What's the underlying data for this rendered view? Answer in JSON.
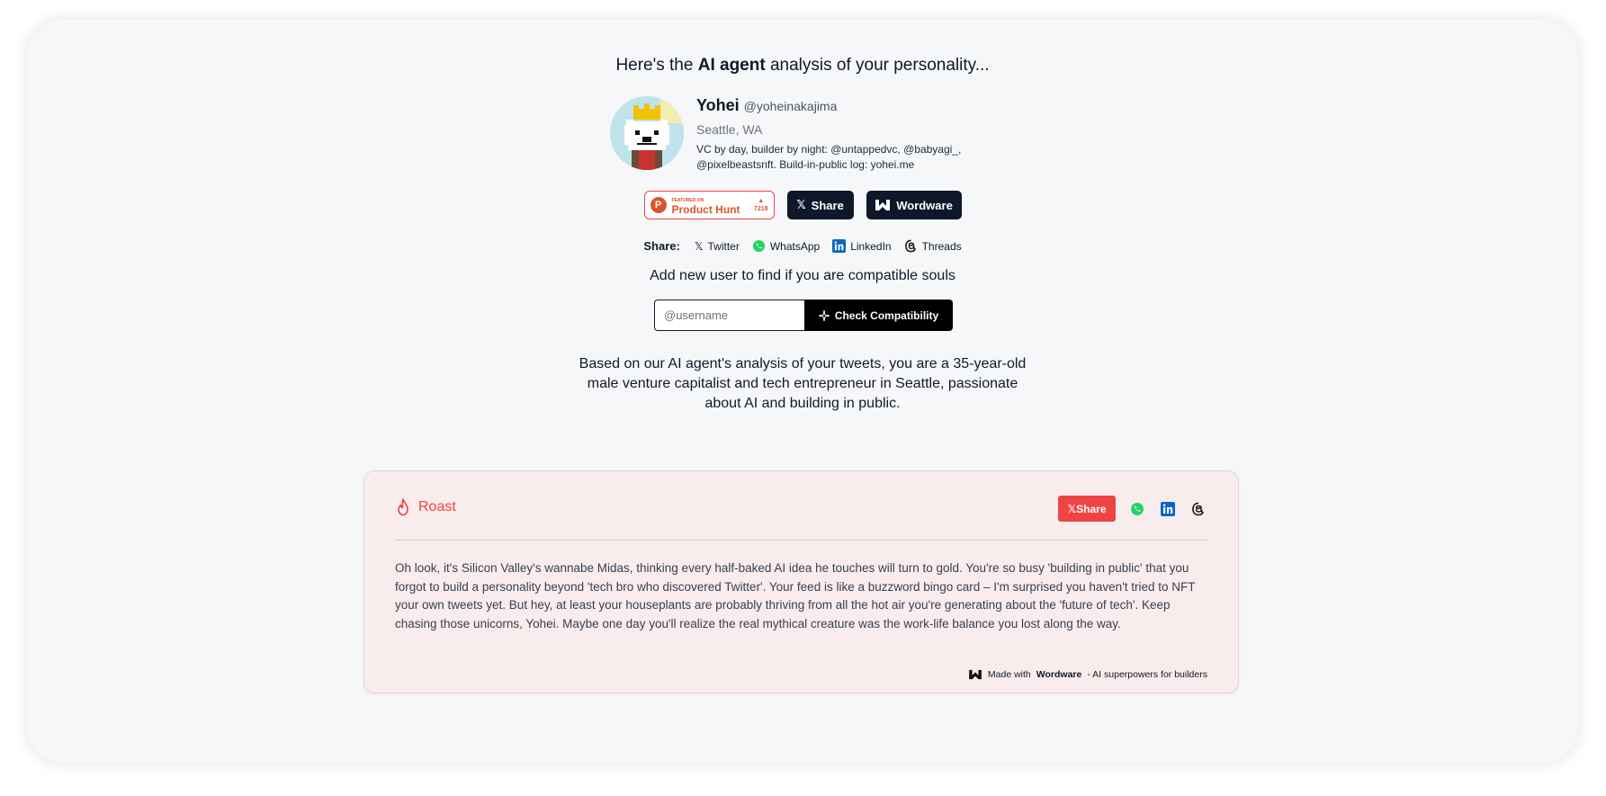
{
  "headline": {
    "prefix": "Here's the ",
    "bold": "AI agent",
    "suffix": " analysis of your personality..."
  },
  "profile": {
    "name": "Yohei",
    "handle": "@yoheinakajima",
    "location": "Seattle, WA",
    "bio": "VC by day, builder by night: @untappedvc, @babyagi_, @pixelbeastsnft. Build-in-public log: yohei.me"
  },
  "buttons": {
    "product_hunt_small": "FEATURED ON",
    "product_hunt_label": "Product Hunt",
    "product_hunt_count": "7218",
    "share_label": "Share",
    "wordware_label": "Wordware"
  },
  "share_row": {
    "label": "Share:",
    "items": [
      {
        "label": "Twitter",
        "icon": "x-icon"
      },
      {
        "label": "WhatsApp",
        "icon": "whatsapp-icon"
      },
      {
        "label": "LinkedIn",
        "icon": "linkedin-icon"
      },
      {
        "label": "Threads",
        "icon": "threads-icon"
      }
    ]
  },
  "compat": {
    "title": "Add new user to find if you are compatible souls",
    "placeholder": "@username",
    "button_label": "Check Compatibility"
  },
  "analysis": "Based on our AI agent's analysis of your tweets, you are a 35-year-old male venture capitalist and tech entrepreneur in Seattle, passionate about AI and building in public.",
  "roast": {
    "title": "Roast",
    "share_label": "Share",
    "text": "Oh look, it's Silicon Valley's wannabe Midas, thinking every half-baked AI idea he touches will turn to gold. You're so busy 'building in public' that you forgot to build a personality beyond 'tech bro who discovered Twitter'. Your feed is like a buzzword bingo card – I'm surprised you haven't tried to NFT your own tweets yet. But hey, at least your houseplants are probably thriving from all the hot air you're generating about the 'future of tech'. Keep chasing those unicorns, Yohei. Maybe one day you'll realize the real mythical creature was the work-life balance you lost along the way.",
    "footer_prefix": "Made with",
    "footer_brand": "Wordware",
    "footer_suffix": "- AI superpowers for builders"
  },
  "colors": {
    "accent_red": "#ef4444",
    "dark": "#0f172a",
    "card_bg": "#f9ecec",
    "page_bg": "#f6f7f9"
  }
}
